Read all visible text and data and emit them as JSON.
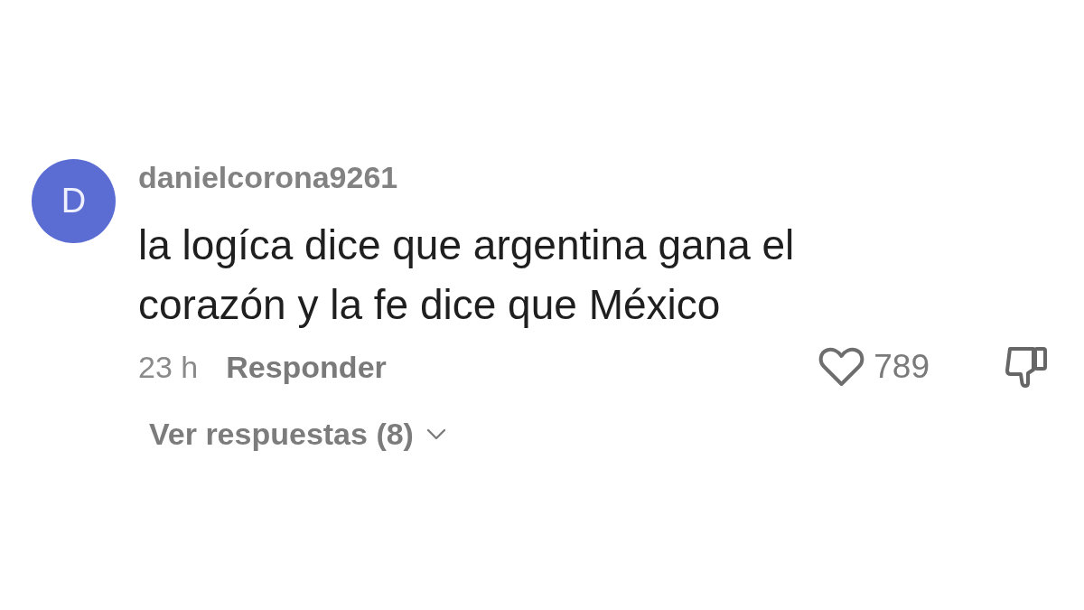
{
  "comment": {
    "avatar": {
      "initial": "D"
    },
    "username": "danielcorona9261",
    "text": "la logíca dice que argentina gana el corazón y la fe dice que México",
    "time": "23 h",
    "reply_label": "Responder",
    "likes": {
      "count": "789",
      "liked": false
    },
    "disliked": false,
    "view_replies": {
      "label": "Ver respuestas (8)",
      "expanded": false
    }
  }
}
